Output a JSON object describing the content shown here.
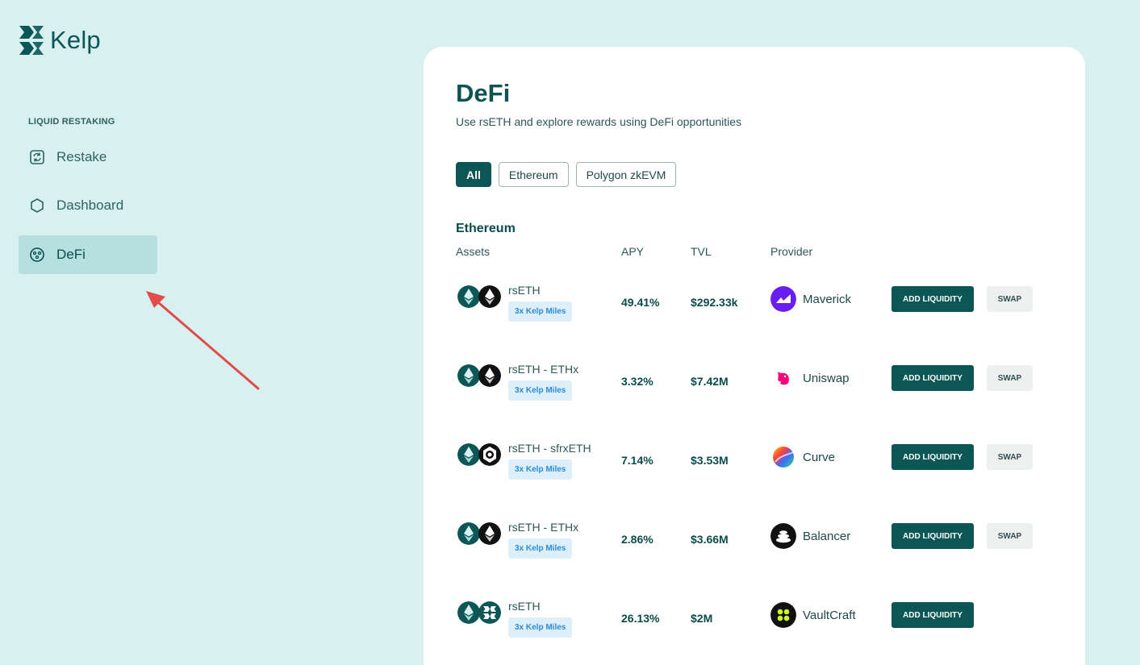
{
  "brand": {
    "name": "Kelp",
    "color": "#0c5656"
  },
  "sidebar": {
    "section_label": "LIQUID RESTAKING",
    "items": [
      {
        "label": "Restake",
        "icon": "restake-icon",
        "active": false
      },
      {
        "label": "Dashboard",
        "icon": "hexagon-icon",
        "active": false
      },
      {
        "label": "DeFi",
        "icon": "defi-icon",
        "active": true
      }
    ]
  },
  "main": {
    "title": "DeFi",
    "subtitle": "Use rsETH and explore rewards using DeFi opportunities",
    "filters": [
      {
        "label": "All",
        "active": true
      },
      {
        "label": "Ethereum",
        "active": false
      },
      {
        "label": "Polygon zkEVM",
        "active": false
      }
    ],
    "group_title": "Ethereum",
    "columns": {
      "assets": "Assets",
      "apy": "APY",
      "tvl": "TVL",
      "provider": "Provider"
    },
    "add_label": "ADD LIQUIDITY",
    "swap_label": "SWAP",
    "rows": [
      {
        "asset": "rsETH",
        "badge": "3x Kelp Miles",
        "apy": "49.41%",
        "tvl": "$292.33k",
        "provider": "Maverick",
        "provider_icon": "maverick-icon",
        "second_icon": "eth-dark-icon",
        "has_swap": true
      },
      {
        "asset": "rsETH - ETHx",
        "badge": "3x Kelp Miles",
        "apy": "3.32%",
        "tvl": "$7.42M",
        "provider": "Uniswap",
        "provider_icon": "uniswap-icon",
        "second_icon": "eth-dark-icon",
        "has_swap": true
      },
      {
        "asset": "rsETH - sfrxETH",
        "badge": "3x Kelp Miles",
        "apy": "7.14%",
        "tvl": "$3.53M",
        "provider": "Curve",
        "provider_icon": "curve-icon",
        "second_icon": "frax-icon",
        "has_swap": true
      },
      {
        "asset": "rsETH - ETHx",
        "badge": "3x Kelp Miles",
        "apy": "2.86%",
        "tvl": "$3.66M",
        "provider": "Balancer",
        "provider_icon": "balancer-icon",
        "second_icon": "eth-dark-icon",
        "has_swap": true
      },
      {
        "asset": "rsETH",
        "badge": "3x Kelp Miles",
        "apy": "26.13%",
        "tvl": "$2M",
        "provider": "VaultCraft",
        "provider_icon": "vaultcraft-icon",
        "second_icon": "kelp-coin-icon",
        "has_swap": false
      }
    ]
  }
}
